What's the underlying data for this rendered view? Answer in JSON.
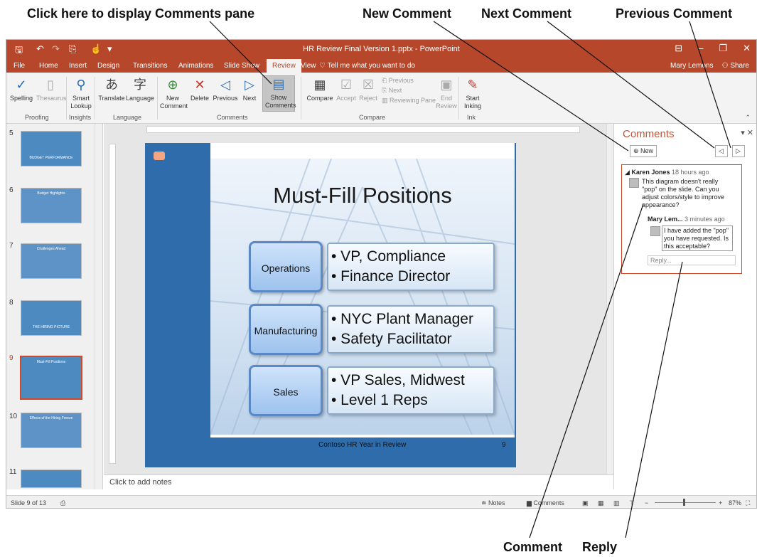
{
  "callouts": {
    "show_comments": "Click here to display Comments pane",
    "new_comment": "New Comment",
    "next_comment": "Next Comment",
    "previous_comment": "Previous Comment",
    "comment": "Comment",
    "reply": "Reply"
  },
  "window": {
    "title": "HR Review Final Version 1.pptx - PowerPoint",
    "user": "Mary Lemons",
    "share": "Share",
    "accent": "#b7472a"
  },
  "tabs": [
    "File",
    "Home",
    "Insert",
    "Design",
    "Transitions",
    "Animations",
    "Slide Show",
    "Review",
    "View"
  ],
  "tell_me": "Tell me what you want to do",
  "ribbon": {
    "spelling": "Spelling",
    "thesaurus": "Thesaurus",
    "smart_lookup": "Smart Lookup",
    "translate": "Translate",
    "language": "Language",
    "new_comment": "New Comment",
    "delete": "Delete",
    "previous": "Previous",
    "next": "Next",
    "show_comments": "Show Comments",
    "compare": "Compare",
    "accept": "Accept",
    "reject": "Reject",
    "prev_small": "Previous",
    "next_small": "Next",
    "reviewing_pane": "Reviewing Pane",
    "end_review": "End Review",
    "start_inking": "Start Inking",
    "groups": {
      "proofing": "Proofing",
      "insights": "Insights",
      "language": "Language",
      "comments": "Comments",
      "compare": "Compare",
      "ink": "Ink"
    }
  },
  "thumbnails": [
    {
      "num": "5",
      "title": "BUDGET PERFORMANCE"
    },
    {
      "num": "6",
      "title": "Budget Highlights"
    },
    {
      "num": "7",
      "title": "Challenges Ahead"
    },
    {
      "num": "8",
      "title": "THE HIRING PICTURE"
    },
    {
      "num": "9",
      "title": "Must-Fill Positions"
    },
    {
      "num": "10",
      "title": "Effects of the Hiring Freeze"
    },
    {
      "num": "11",
      "title": ""
    }
  ],
  "slide": {
    "title": "Must-Fill Positions",
    "rows": [
      {
        "label": "Operations",
        "items": [
          "• VP, Compliance",
          "• Finance Director"
        ]
      },
      {
        "label": "Manufacturing",
        "items": [
          "• NYC Plant Manager",
          "• Safety Facilitator"
        ]
      },
      {
        "label": "Sales",
        "items": [
          "• VP Sales, Midwest",
          "• Level 1 Reps"
        ]
      }
    ],
    "footer": "Contoso HR Year in Review",
    "page_number": "9"
  },
  "notes_placeholder": "Click to add notes",
  "comments_pane": {
    "title": "Comments",
    "new_button": "New",
    "comment": {
      "author": "Karen Jones",
      "time": "18 hours ago",
      "text": "This diagram doesn't really \"pop\" on the slide. Can you adjust colors/style to improve appearance?"
    },
    "reply": {
      "author": "Mary Lem...",
      "time": "3 minutes ago",
      "text": "I have added the \"pop\" you have requested. Is this acceptable?"
    },
    "reply_placeholder": "Reply..."
  },
  "status": {
    "slide_info": "Slide 9 of 13",
    "notes": "Notes",
    "comments": "Comments",
    "zoom": "87%"
  }
}
